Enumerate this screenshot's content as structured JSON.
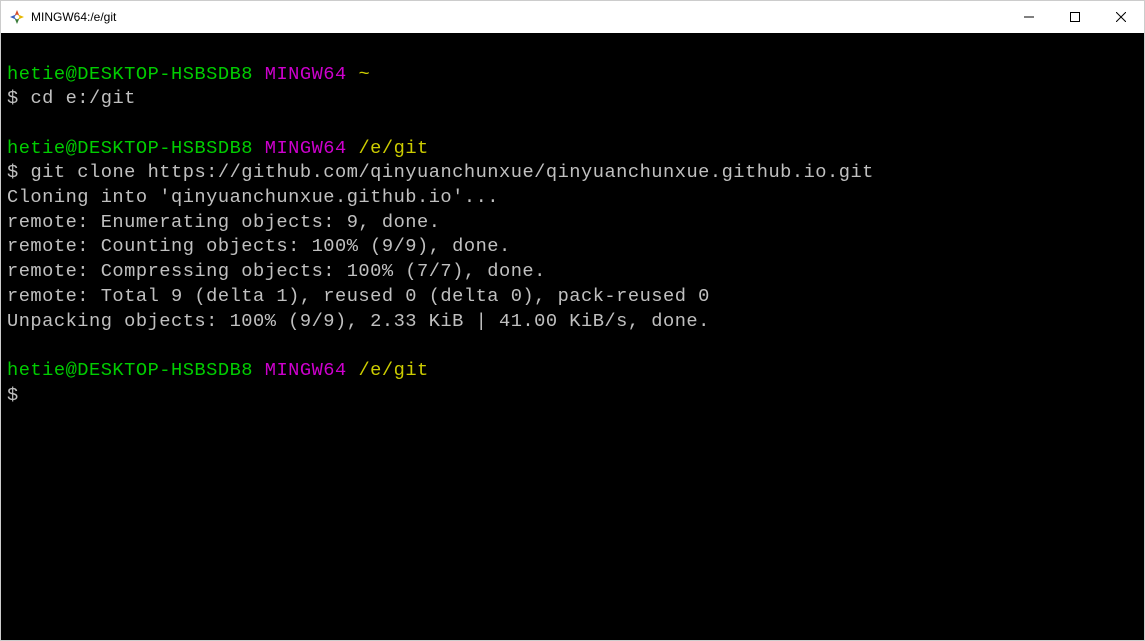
{
  "window": {
    "title": "MINGW64:/e/git"
  },
  "prompt1": {
    "userhost": "hetie@DESKTOP-HSBSDB8",
    "env": "MINGW64",
    "path": "~",
    "dollar": "$",
    "command": "cd e:/git"
  },
  "prompt2": {
    "userhost": "hetie@DESKTOP-HSBSDB8",
    "env": "MINGW64",
    "path": "/e/git",
    "dollar": "$",
    "command": "git clone https://github.com/qinyuanchunxue/qinyuanchunxue.github.io.git"
  },
  "output": {
    "l1": "Cloning into 'qinyuanchunxue.github.io'...",
    "l2": "remote: Enumerating objects: 9, done.",
    "l3": "remote: Counting objects: 100% (9/9), done.",
    "l4": "remote: Compressing objects: 100% (7/7), done.",
    "l5": "remote: Total 9 (delta 1), reused 0 (delta 0), pack-reused 0",
    "l6": "Unpacking objects: 100% (9/9), 2.33 KiB | 41.00 KiB/s, done."
  },
  "prompt3": {
    "userhost": "hetie@DESKTOP-HSBSDB8",
    "env": "MINGW64",
    "path": "/e/git",
    "dollar": "$",
    "command": ""
  }
}
